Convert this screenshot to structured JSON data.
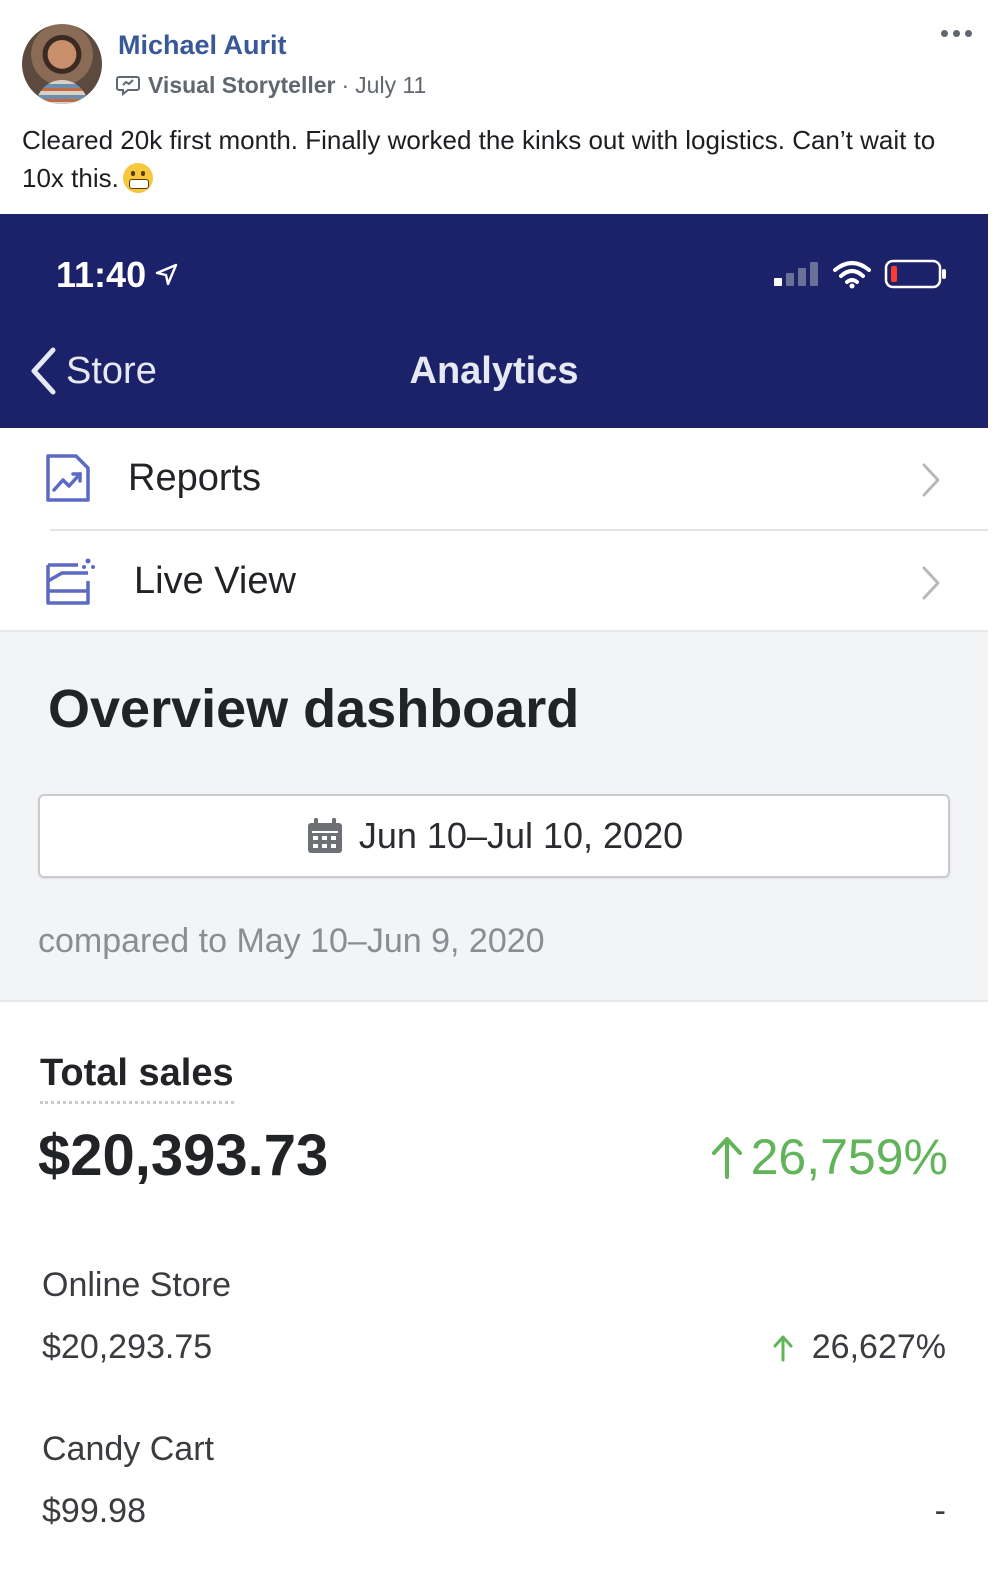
{
  "post": {
    "author": "Michael Aurit",
    "badge": "Visual Storyteller",
    "separator": "·",
    "date": "July 11",
    "text": "Cleared 20k first month. Finally worked the kinks out with logistics. Can’t wait to 10x this.",
    "emoji": "grimacing-face-emoji"
  },
  "phone": {
    "status": {
      "time": "11:40",
      "battery": "low"
    },
    "nav": {
      "back_label": "Store",
      "title": "Analytics"
    },
    "menu": [
      {
        "label": "Reports",
        "icon": "reports-chart-icon"
      },
      {
        "label": "Live View",
        "icon": "live-view-icon"
      }
    ],
    "overview": {
      "title": "Overview dashboard",
      "date_range": "Jun 10–Jul 10, 2020",
      "compared": "compared to May 10–Jun 9, 2020"
    },
    "sales": {
      "label": "Total sales",
      "value": "$20,393.73",
      "change": "26,759%",
      "channels": [
        {
          "name": "Online Store",
          "value": "$20,293.75",
          "change": "26,627%"
        },
        {
          "name": "Candy Cart",
          "value": "$99.98",
          "change": "-"
        }
      ]
    }
  },
  "colors": {
    "fb_link": "#385898",
    "nav_bg": "#1b2269",
    "positive": "#62b45a",
    "icon_accent": "#5c6ac4"
  }
}
